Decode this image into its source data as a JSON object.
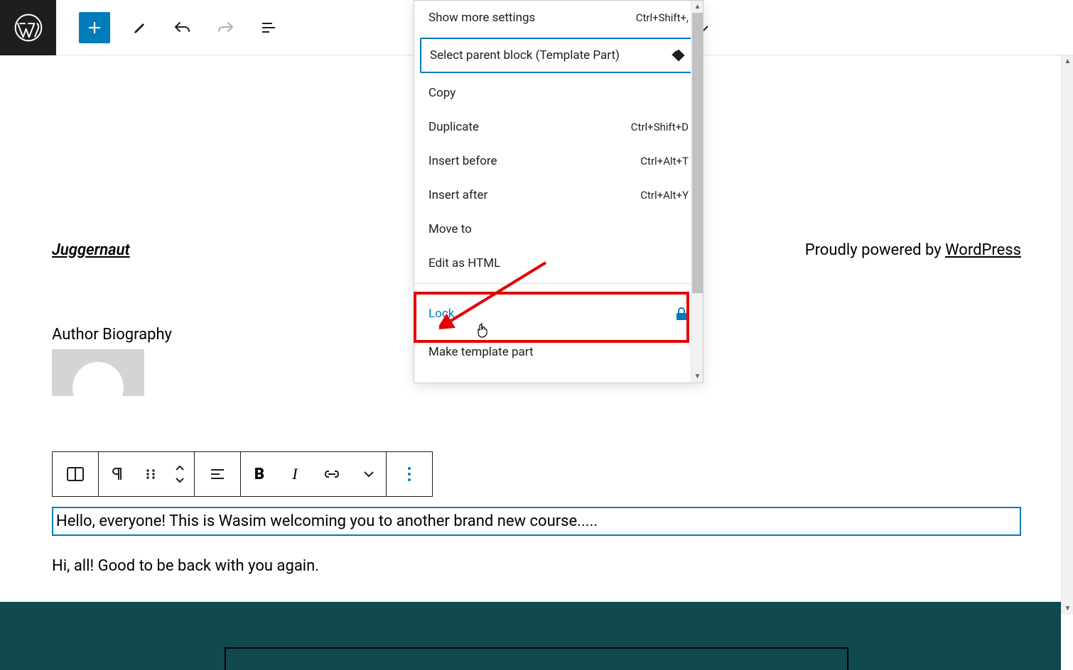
{
  "menu": {
    "show_more_settings": "Show more settings",
    "show_more_settings_shortcut": "Ctrl+Shift+,",
    "select_parent": "Select parent block (Template Part)",
    "copy": "Copy",
    "duplicate": "Duplicate",
    "duplicate_shortcut": "Ctrl+Shift+D",
    "insert_before": "Insert before",
    "insert_before_shortcut": "Ctrl+Alt+T",
    "insert_after": "Insert after",
    "insert_after_shortcut": "Ctrl+Alt+Y",
    "move_to": "Move to",
    "edit_html": "Edit as HTML",
    "lock": "Lock",
    "make_template_part": "Make template part"
  },
  "content": {
    "site_title": "Juggernaut",
    "powered_by_prefix": "Proudly powered by ",
    "powered_by_link": "WordPress",
    "author_bio_title": "Author Biography",
    "para1": "Hello, everyone! This is Wasim welcoming you to another brand new course.....",
    "para2": "Hi, all! Good to be back with you again."
  }
}
